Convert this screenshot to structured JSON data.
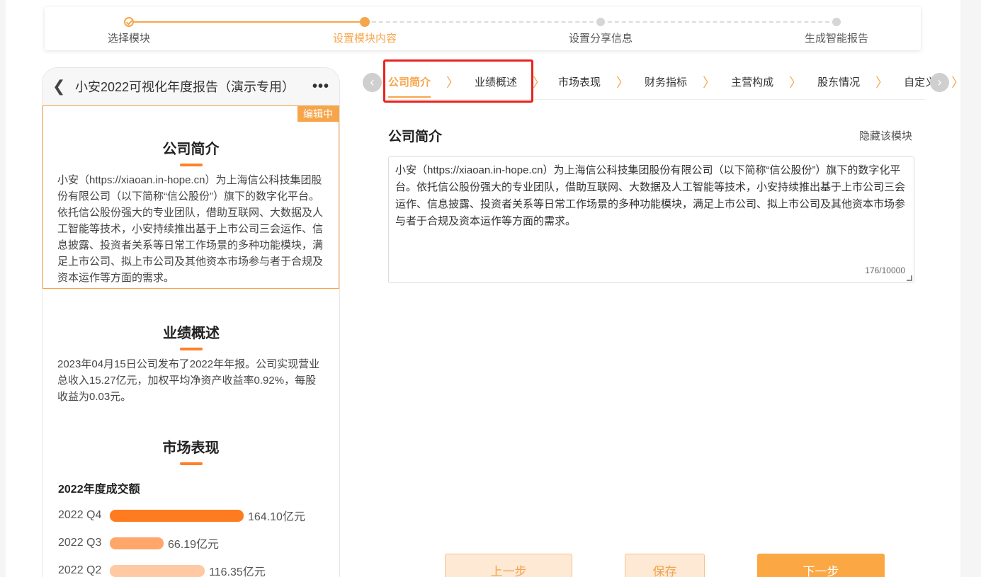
{
  "stepper": {
    "steps": [
      {
        "label": "选择模块",
        "state": "done"
      },
      {
        "label": "设置模块内容",
        "state": "active"
      },
      {
        "label": "设置分享信息",
        "state": "todo"
      },
      {
        "label": "生成智能报告",
        "state": "todo"
      }
    ]
  },
  "preview": {
    "title": "小安2022可视化年度报告（演示专用）",
    "edit_badge": "编辑中",
    "sections": {
      "intro": {
        "title": "公司简介",
        "text": "小安（https://xiaoan.in-hope.cn）为上海信公科技集团股份有限公司（以下简称“信公股份”）旗下的数字化平台。依托信公股份强大的专业团队，借助互联网、大数据及人工智能等技术，小安持续推出基于上市公司三会运作、信息披露、投资者关系等日常工作场景的多种功能模块，满足上市公司、拟上市公司及其他资本市场参与者于合规及资本运作等方面的需求。"
      },
      "performance": {
        "title": "业绩概述",
        "text": "2023年04月15日公司发布了2022年年报。公司实现营业总收入15.27亿元，加权平均净资产收益率0.92%，每股收益为0.03元。"
      },
      "market": {
        "title": "市场表现",
        "chart_title": "2022年度成交额"
      }
    }
  },
  "chart_data": {
    "type": "bar",
    "title": "2022年度成交额",
    "categories": [
      "2022 Q4",
      "2022 Q3",
      "2022 Q2"
    ],
    "values": [
      164.1,
      66.19,
      116.35
    ],
    "value_labels": [
      "164.10亿元",
      "66.19亿元",
      "116.35亿元"
    ],
    "unit": "亿元",
    "colors": [
      "#ff7b1f",
      "#ffa66b",
      "#ffc9a3"
    ],
    "xlim": [
      0,
      164.1
    ]
  },
  "tabs": {
    "items": [
      "公司简介",
      "业绩概述",
      "市场表现",
      "财务指标",
      "主营构成",
      "股东情况",
      "自定义"
    ],
    "active_index": 0,
    "separator": "〉",
    "prev_icon": "‹",
    "next_icon": "›"
  },
  "editor": {
    "title": "公司简介",
    "hide_label": "隐藏该模块",
    "content": "小安（https://xiaoan.in-hope.cn）为上海信公科技集团股份有限公司（以下简称“信公股份”）旗下的数字化平台。依托信公股份强大的专业团队，借助互联网、大数据及人工智能等技术，小安持续推出基于上市公司三会运作、信息披露、投资者关系等日常工作场景的多种功能模块，满足上市公司、拟上市公司及其他资本市场参与者于合规及资本运作等方面的需求。",
    "char_count": "176/10000"
  },
  "buttons": {
    "prev": "上一步",
    "save": "保存",
    "next": "下一步"
  },
  "colors": {
    "accent": "#f7a54a",
    "highlight": "#e8231e"
  }
}
